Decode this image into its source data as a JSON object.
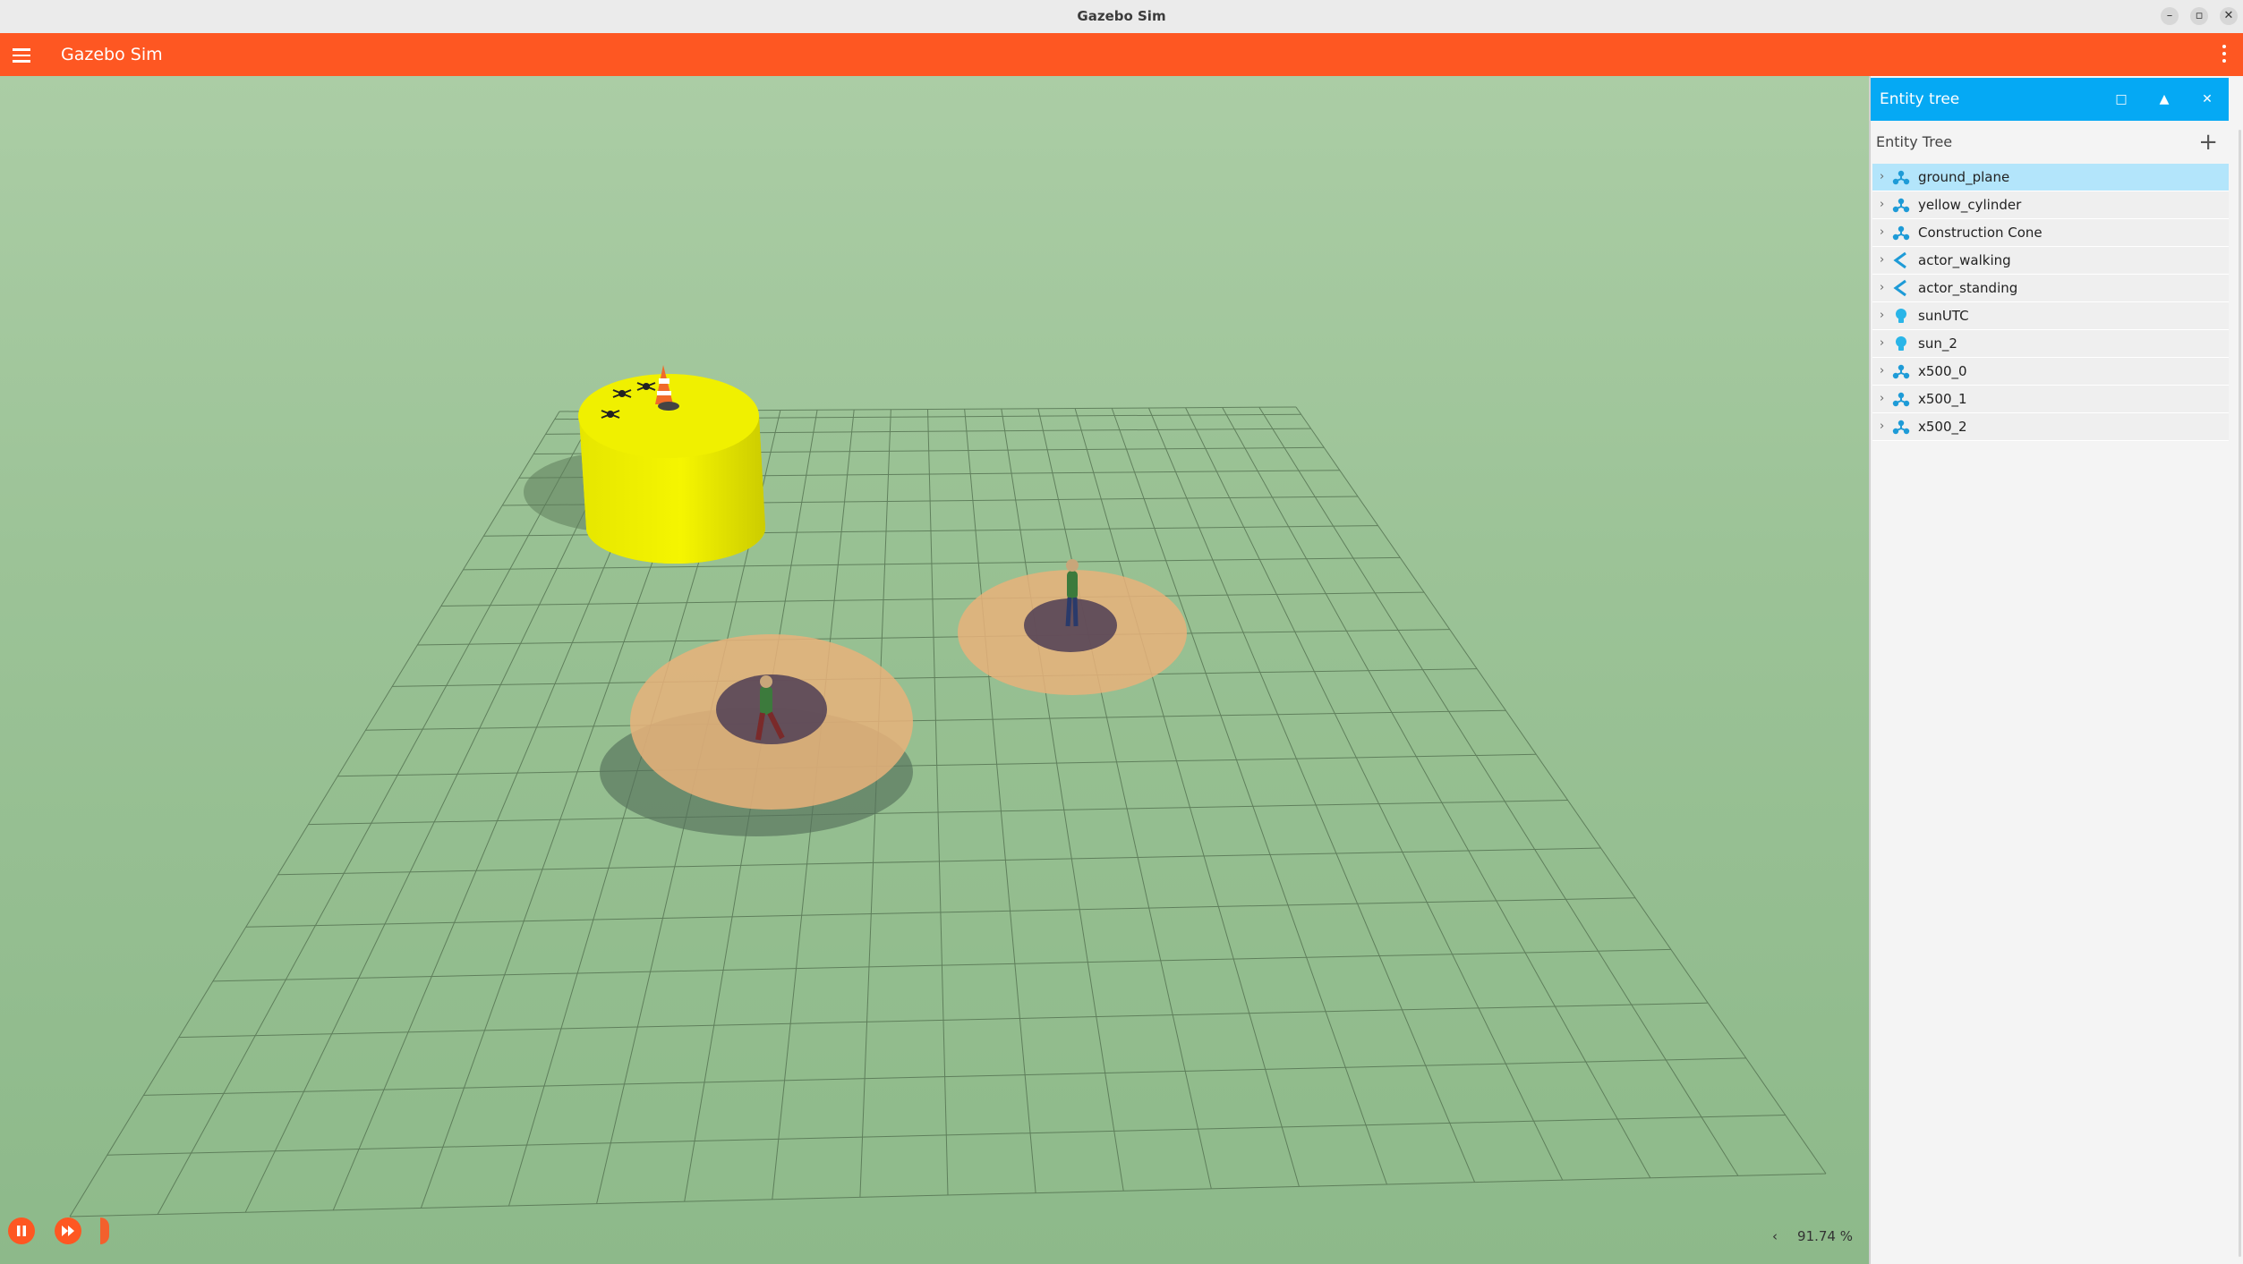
{
  "window": {
    "title": "Gazebo Sim",
    "controls": [
      "minimize-icon",
      "restore-icon",
      "close-icon"
    ]
  },
  "header": {
    "title": "Gazebo Sim",
    "menu_icon": "hamburger-menu-icon",
    "more_icon": "more-vertical-icon",
    "color": "#fe5722"
  },
  "panel": {
    "title": "Entity tree",
    "subtitle": "Entity Tree",
    "add_icon": "plus-icon",
    "header_color": "#05a9f4",
    "selected_color": "#b3e5fb",
    "items": [
      {
        "label": "ground_plane",
        "icon": "model-icon",
        "selected": true
      },
      {
        "label": "yellow_cylinder",
        "icon": "model-icon",
        "selected": false
      },
      {
        "label": "Construction Cone",
        "icon": "model-icon",
        "selected": false
      },
      {
        "label": "actor_walking",
        "icon": "actor-icon",
        "selected": false
      },
      {
        "label": "actor_standing",
        "icon": "actor-icon",
        "selected": false
      },
      {
        "label": "sunUTC",
        "icon": "light-icon",
        "selected": false
      },
      {
        "label": "sun_2",
        "icon": "light-icon",
        "selected": false
      },
      {
        "label": "x500_0",
        "icon": "model-icon",
        "selected": false
      },
      {
        "label": "x500_1",
        "icon": "model-icon",
        "selected": false
      },
      {
        "label": "x500_2",
        "icon": "model-icon",
        "selected": false
      }
    ]
  },
  "viewport": {
    "real_time_factor": "91.74 %",
    "controls": [
      "pause-icon",
      "step-forward-icon"
    ]
  }
}
